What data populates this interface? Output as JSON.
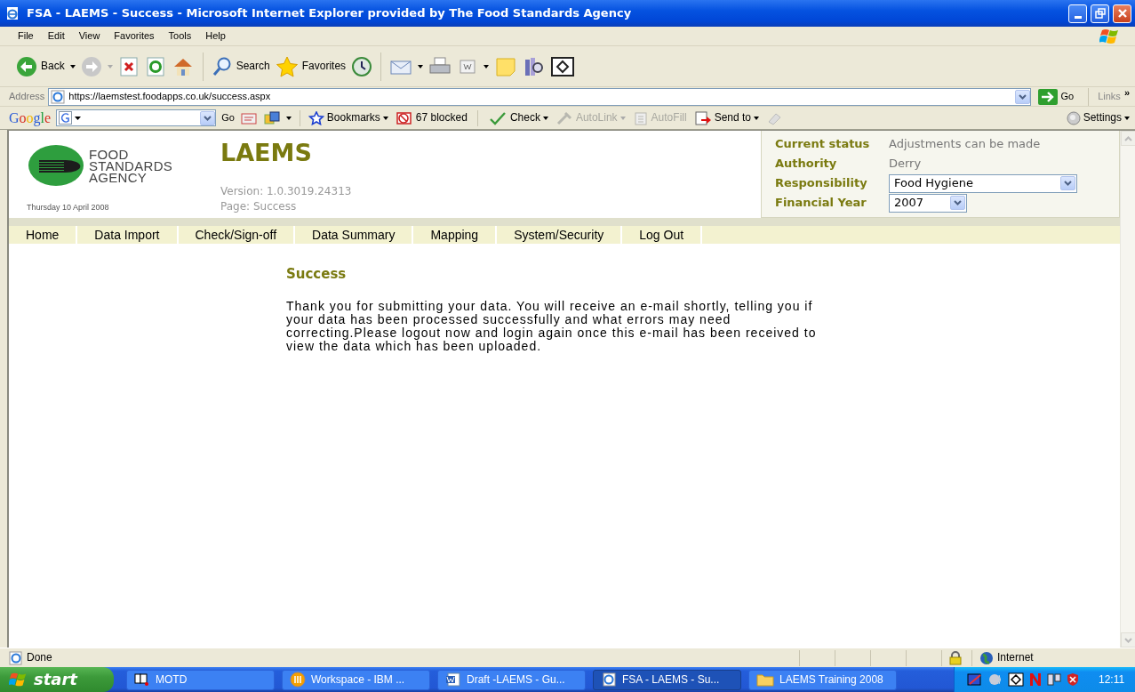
{
  "window": {
    "title": "FSA - LAEMS - Success - Microsoft Internet Explorer provided by The Food Standards Agency"
  },
  "menu_bar": [
    "File",
    "Edit",
    "View",
    "Favorites",
    "Tools",
    "Help"
  ],
  "toolbar": {
    "back": "Back",
    "search": "Search",
    "favorites": "Favorites"
  },
  "address_bar": {
    "label": "Address",
    "url": "https://laemstest.foodapps.co.uk/success.aspx",
    "go": "Go",
    "links": "Links",
    "more": "»"
  },
  "google_toolbar": {
    "logo": "Google",
    "go": "Go",
    "items": [
      {
        "label": "Bookmarks",
        "disabled": false
      },
      {
        "label": "67 blocked",
        "disabled": false
      },
      {
        "label": "Check",
        "disabled": false
      },
      {
        "label": "AutoLink",
        "disabled": true
      },
      {
        "label": "AutoFill",
        "disabled": true
      },
      {
        "label": "Send to",
        "disabled": false
      }
    ],
    "settings": "Settings"
  },
  "page": {
    "agency": [
      "FOOD",
      "STANDARDS",
      "AGENCY"
    ],
    "date": "Thursday 10 April 2008",
    "app_title": "LAEMS",
    "version": "Version: 1.0.3019.24313",
    "page": "Page: Success"
  },
  "status_panel": [
    {
      "kind": "text",
      "label": "Current status",
      "value": "Adjustments can be made"
    },
    {
      "kind": "text",
      "label": "Authority",
      "value": "Derry"
    },
    {
      "kind": "select",
      "label": "Responsibility",
      "value": "Food Hygiene"
    },
    {
      "kind": "select",
      "label": "Financial Year",
      "value": "2007"
    }
  ],
  "nav": [
    "Home",
    "Data Import",
    "Check/Sign-off",
    "Data Summary",
    "Mapping",
    "System/Security",
    "Log Out"
  ],
  "content": {
    "heading": "Success",
    "message": "Thank you for submitting your data. You will receive an e-mail shortly, telling you if your data has been processed successfully and what errors may need correcting.Please logout now and login again once this e-mail has been received to view the data which has been uploaded."
  },
  "status_bar": {
    "text": "Done",
    "zone": "Internet"
  },
  "taskbar": {
    "start": "start",
    "tasks": [
      {
        "label": "MOTD",
        "selected": false
      },
      {
        "label": "Workspace - IBM ...",
        "selected": false
      },
      {
        "label": "Draft -LAEMS - Gu...",
        "selected": false
      },
      {
        "label": "FSA - LAEMS - Su...",
        "selected": true
      },
      {
        "label": "LAEMS Training 2008",
        "selected": false
      }
    ],
    "clock": "12:11"
  }
}
